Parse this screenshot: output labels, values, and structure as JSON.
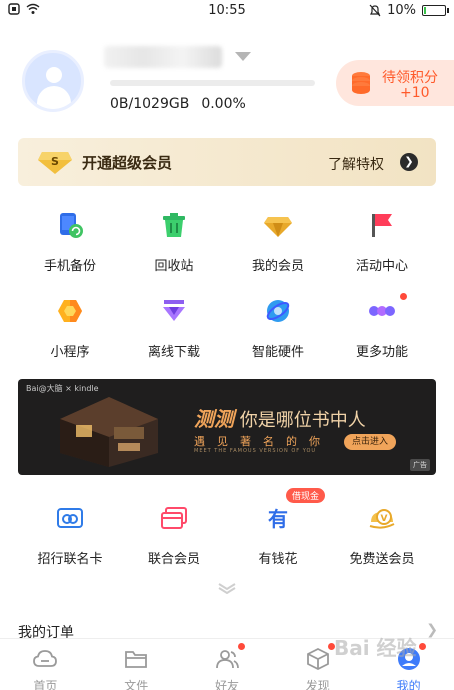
{
  "status_bar": {
    "time": "10:55",
    "battery": "10%",
    "battery_level": 0.1
  },
  "profile": {
    "quota": "0B/1029GB",
    "percent": "0.00%",
    "quota_fraction": 0.0,
    "points": {
      "label": "待领积分",
      "value": "+10"
    }
  },
  "vip": {
    "title": "开通超级会员",
    "link": "了解特权"
  },
  "grid_row1": [
    {
      "label": "手机备份",
      "icon": "phone-backup-icon"
    },
    {
      "label": "回收站",
      "icon": "recycle-bin-icon"
    },
    {
      "label": "我的会员",
      "icon": "vip-diamond-icon"
    },
    {
      "label": "活动中心",
      "icon": "flag-icon"
    }
  ],
  "grid_row2": [
    {
      "label": "小程序",
      "icon": "mini-program-icon"
    },
    {
      "label": "离线下载",
      "icon": "offline-download-icon"
    },
    {
      "label": "智能硬件",
      "icon": "smart-hardware-icon"
    },
    {
      "label": "更多功能",
      "icon": "more-icon"
    }
  ],
  "ad": {
    "brand": "Bai@大脑 × kindle",
    "headline_em": "测测",
    "headline": "你是哪位书中人",
    "sub": "遇见著名的你",
    "tiny": "MEET THE FAMOUS VERSION OF YOU",
    "cta": "点击进入",
    "tag": "广告"
  },
  "grid_row3": [
    {
      "label": "招行联名卡",
      "icon": "cmb-card-icon"
    },
    {
      "label": "联合会员",
      "icon": "joint-member-icon"
    },
    {
      "label": "有钱花",
      "icon": "youqianhua-icon",
      "badge": "借现金"
    },
    {
      "label": "免费送会员",
      "icon": "free-vip-icon"
    }
  ],
  "orders": {
    "title": "我的订单"
  },
  "tabs": [
    {
      "label": "首页",
      "icon": "cloud-icon"
    },
    {
      "label": "文件",
      "icon": "folder-icon"
    },
    {
      "label": "好友",
      "icon": "friends-icon"
    },
    {
      "label": "发现",
      "icon": "discover-icon"
    },
    {
      "label": "我的",
      "icon": "me-icon"
    }
  ],
  "watermark": "Bai 经验",
  "colors": {
    "accent": "#3e7bfa",
    "points": "#ff5a2b",
    "vip_bg": "#f4e7c9"
  }
}
